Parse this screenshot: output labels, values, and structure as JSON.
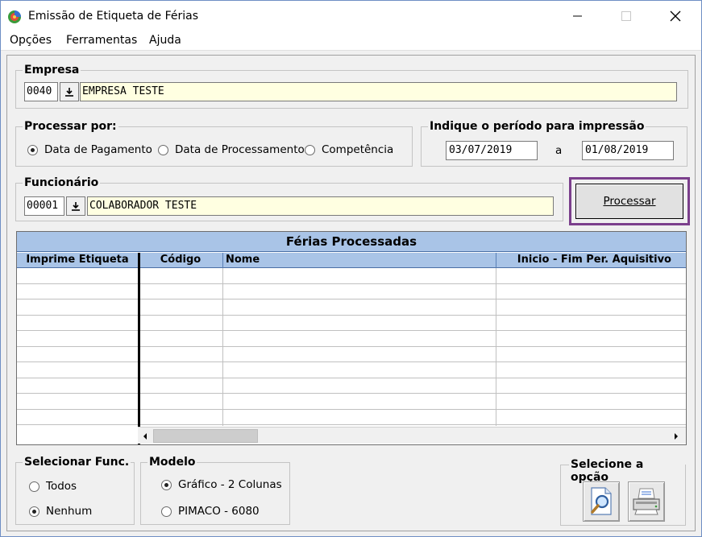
{
  "window": {
    "title": "Emissão de Etiqueta de Férias"
  },
  "menu": [
    "Opções",
    "Ferramentas",
    "Ajuda"
  ],
  "empresa": {
    "label": "Empresa",
    "code": "0040",
    "name": "EMPRESA TESTE"
  },
  "processar_por": {
    "label": "Processar por:",
    "options": [
      "Data de Pagamento",
      "Data de Processamento",
      "Competência"
    ],
    "selected": "Data de Pagamento"
  },
  "periodo": {
    "label": "Indique o período para impressão",
    "start": "03/07/2019",
    "separator": "a",
    "end": "01/08/2019"
  },
  "funcionario": {
    "label": "Funcionário",
    "code": "00001",
    "name": "COLABORADOR TESTE"
  },
  "process_button": "Processar",
  "grid": {
    "title": "Férias Processadas",
    "columns": [
      "Imprime Etiqueta",
      "Código",
      "Nome",
      "Inicio - Fim Per. Aquisitivo"
    ],
    "rows": []
  },
  "selecionar_func": {
    "label": "Selecionar Func.",
    "options": [
      "Todos",
      "Nenhum"
    ],
    "selected": "Nenhum"
  },
  "modelo": {
    "label": "Modelo",
    "options": [
      "Gráfico - 2 Colunas",
      "PIMACO - 6080"
    ],
    "selected": "Gráfico - 2 Colunas"
  },
  "selecione_opcao": {
    "label": "Selecione a opção",
    "buttons": [
      "preview-icon",
      "printer-icon"
    ]
  }
}
